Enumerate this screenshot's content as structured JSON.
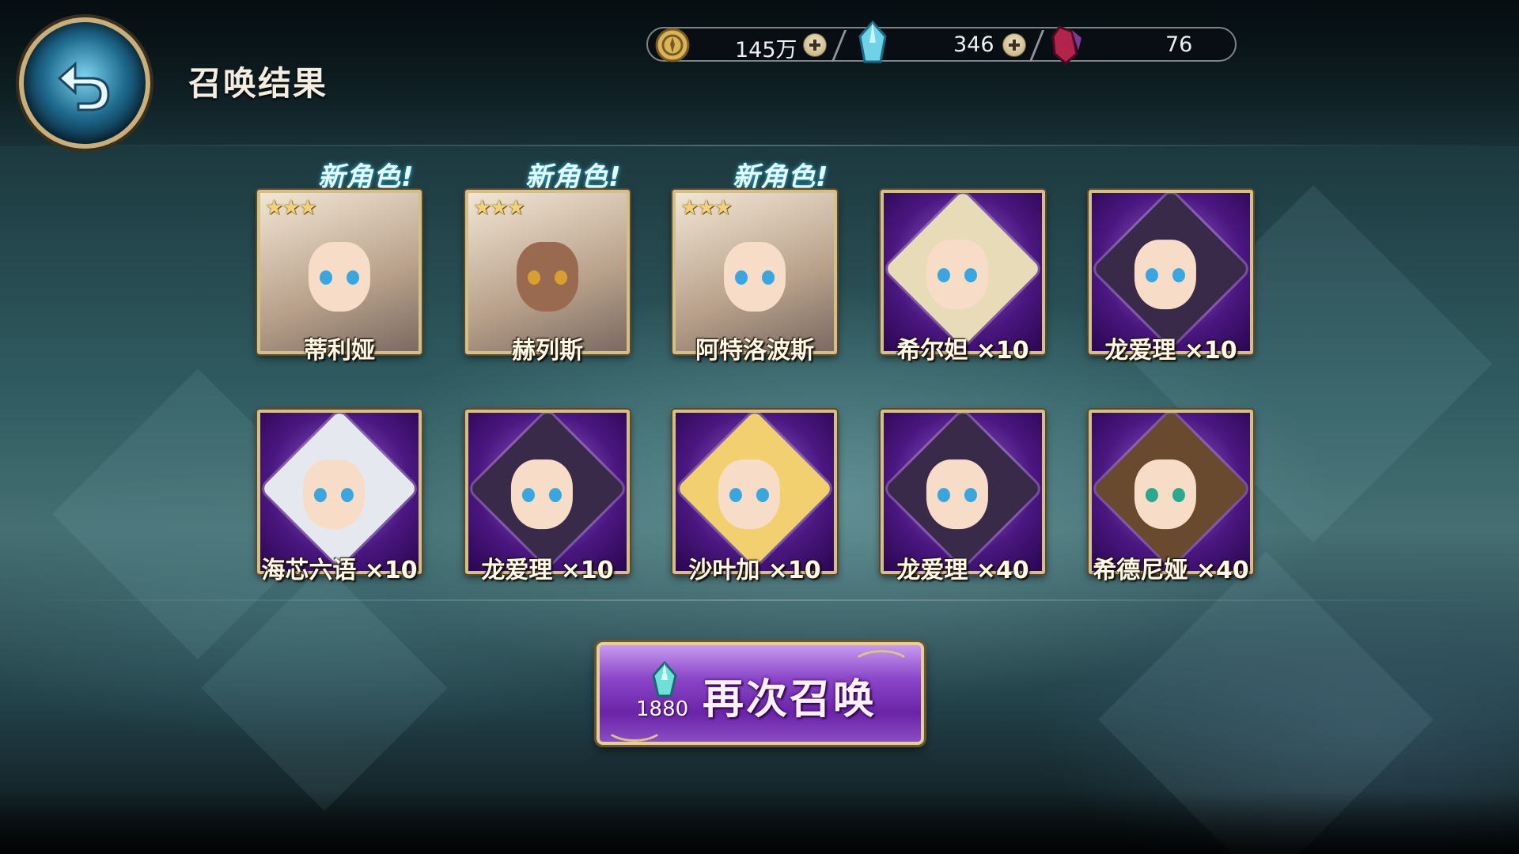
{
  "header": {
    "title": "召唤结果",
    "back_icon": "return-arrow-icon"
  },
  "currencies": [
    {
      "icon": "gold-coin-icon",
      "value": "145万",
      "color": "#d9b45a"
    },
    {
      "icon": "blue-crystal-icon",
      "value": "346",
      "color": "#6fd3e8"
    },
    {
      "icon": "red-crystal-icon",
      "value": "76",
      "color": "#b2244a"
    }
  ],
  "new_label": "新角色!",
  "results": [
    {
      "name": "蒂利娅",
      "stars": "★★★",
      "is_new": true,
      "type": "hero",
      "hair": "#1d1f2e"
    },
    {
      "name": "赫列斯",
      "stars": "★★★",
      "is_new": true,
      "type": "hero",
      "hair": "#dcdcdc"
    },
    {
      "name": "阿特洛波斯",
      "stars": "★★★",
      "is_new": true,
      "type": "hero",
      "hair": "#f2d48a"
    },
    {
      "name": "希尔妲 ×10",
      "stars": "",
      "is_new": false,
      "type": "shard",
      "hair": "#e8dcb8"
    },
    {
      "name": "龙爱理 ×10",
      "stars": "",
      "is_new": false,
      "type": "shard",
      "hair": "#3a2a4a"
    },
    {
      "name": "海芯六语 ×10",
      "stars": "",
      "is_new": false,
      "type": "shard",
      "hair": "#e6e8f0"
    },
    {
      "name": "龙爱理 ×10",
      "stars": "",
      "is_new": false,
      "type": "shard",
      "hair": "#3a2a4a"
    },
    {
      "name": "沙叶加 ×10",
      "stars": "",
      "is_new": false,
      "type": "shard",
      "hair": "#f2d070"
    },
    {
      "name": "龙爱理 ×40",
      "stars": "",
      "is_new": false,
      "type": "shard",
      "hair": "#3a2a4a"
    },
    {
      "name": "希德尼娅 ×40",
      "stars": "",
      "is_new": false,
      "type": "shard",
      "hair": "#6a4a2e"
    }
  ],
  "summon_again": {
    "label": "再次召唤",
    "cost": "1880",
    "cost_icon": "blue-crystal-icon"
  }
}
